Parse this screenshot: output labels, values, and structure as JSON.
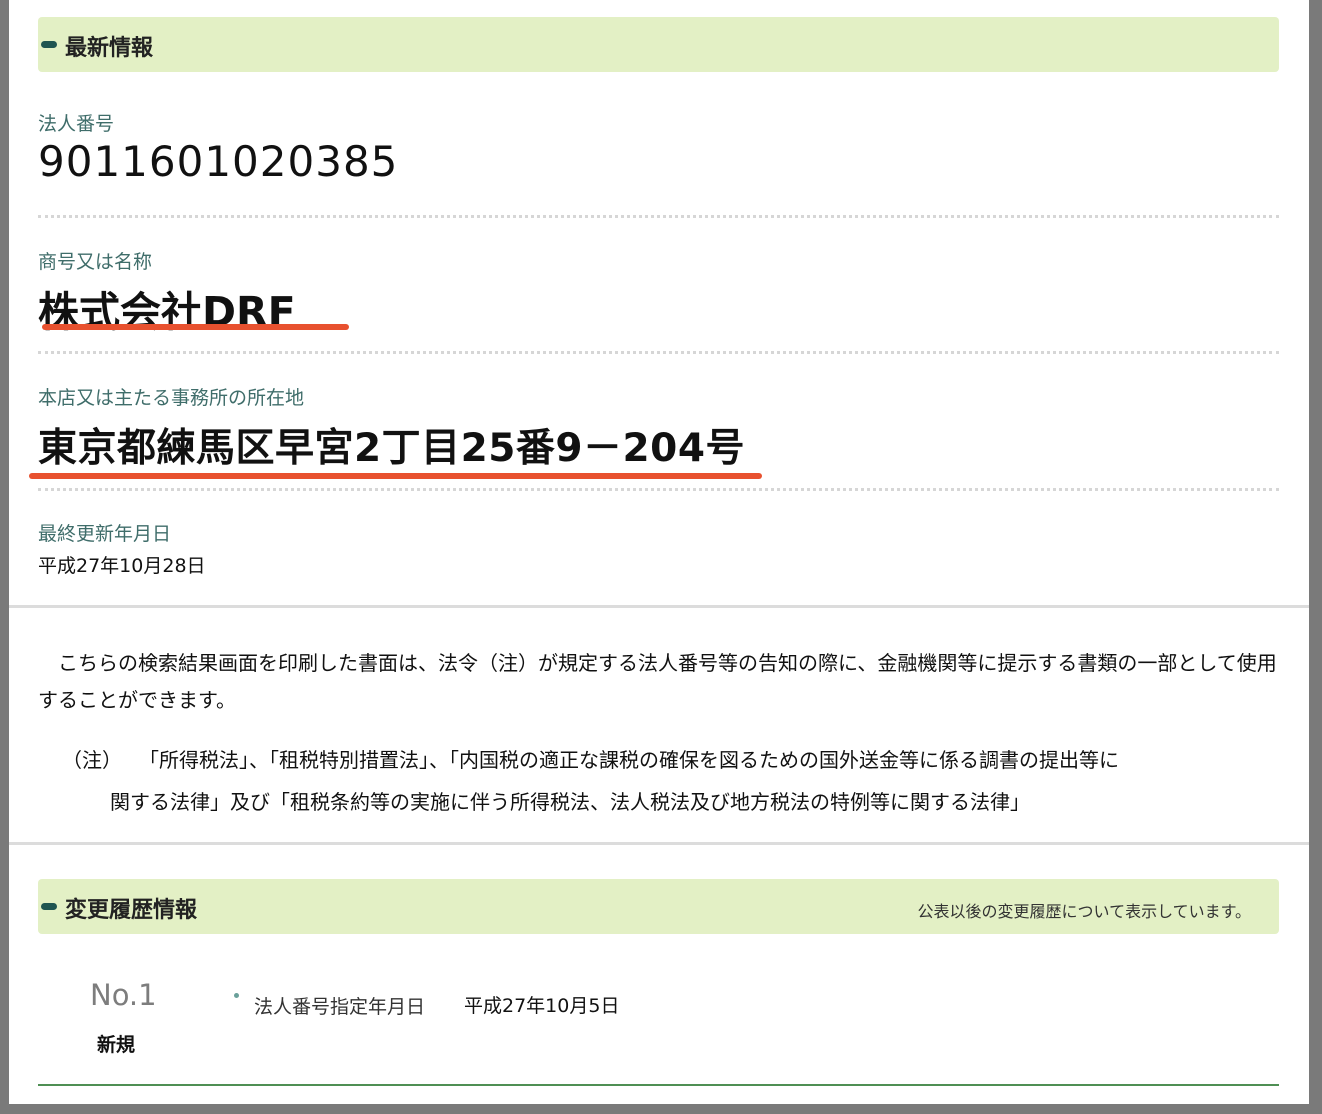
{
  "latest": {
    "section_title": "最新情報",
    "corporate_number_label": "法人番号",
    "corporate_number": "9011601020385",
    "name_label": "商号又は名称",
    "name": "株式会社DRF",
    "address_label": "本店又は主たる事務所の所在地",
    "address": "東京都練馬区早宮2丁目25番9－204号",
    "updated_label": "最終更新年月日",
    "updated": "平成27年10月28日"
  },
  "notice": {
    "paragraph": "　こちらの検索結果画面を印刷した書面は、法令（注）が規定する法人番号等の告知の際に、金融機関等に提示する書類の一部として使用することができます。",
    "note_mark": "（注）",
    "note_line1": "「所得税法」、「租税特別措置法」、「内国税の適正な課税の確保を図るための国外送金等に係る調書の提出等に",
    "note_line2": "関する法律」及び「租税条約等の実施に伴う所得税法、法人税法及び地方税法の特例等に関する法律」"
  },
  "history": {
    "section_title": "変更履歴情報",
    "section_note": "公表以後の変更履歴について表示しています。",
    "entries": [
      {
        "no": "No.1",
        "kind": "新規",
        "item_label": "法人番号指定年月日",
        "item_value": "平成27年10月5日"
      }
    ]
  },
  "colors": {
    "section_bar": "#e3f0c5",
    "label_text": "#3f6d6a",
    "highlight_underline": "#e8512f",
    "rule_green": "#4f8f54"
  }
}
